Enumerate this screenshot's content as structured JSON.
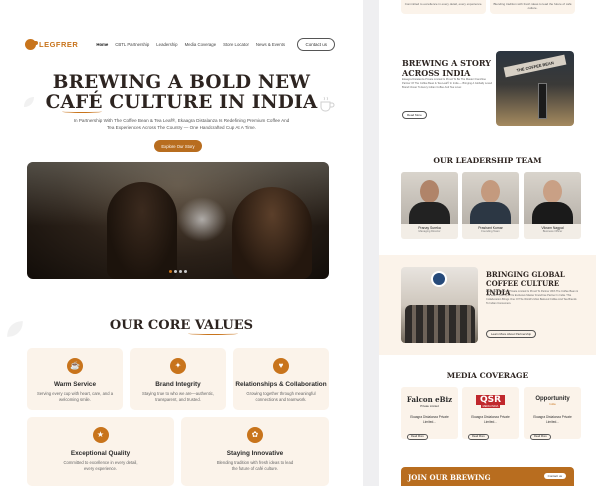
{
  "brand": {
    "logo_text": "LEGFRER",
    "accent": "#c8741c"
  },
  "nav": {
    "links": [
      "Home",
      "CBTL Partnership",
      "Leadership",
      "Media Coverage",
      "Store Locator",
      "News & Events"
    ],
    "contact": "Contact us"
  },
  "hero": {
    "title_line1": "BREWING A BOLD NEW",
    "title_line2": "CAFÉ CULTURE IN INDIA",
    "subtitle": "In Partnership With The Coffee Bean & Tea Leaf®, Ekaagra Distalanza Is Redefining Premium Coffee And Tea Experiences Across The Country — One Handcrafted Cup At A Time.",
    "cta": "Explore Our Story",
    "slider_count": 4,
    "slider_active": 0
  },
  "values": {
    "title": "OUR CORE VALUES",
    "cards": [
      {
        "title": "Warm Service",
        "desc": "Serving every cup with heart, care, and a welcoming smile.",
        "icon": "☕"
      },
      {
        "title": "Brand Integrity",
        "desc": "Staying true to who we are—authentic, transparent, and trusted.",
        "icon": "✦"
      },
      {
        "title": "Relationships & Collaboration",
        "desc": "Growing together through meaningful connections and teamwork.",
        "icon": "♥"
      },
      {
        "title": "Exceptional Quality",
        "desc": "Committed to excellence in every detail, every experience.",
        "icon": "★"
      },
      {
        "title": "Staying Innovative",
        "desc": "Blending tradition with fresh ideas to lead the future of café culture.",
        "icon": "✿"
      }
    ]
  },
  "right": {
    "top_cards": [
      "Committed to excellence in every detail, every experience.",
      "Blending tradition with fresh ideas to lead the future of café culture."
    ],
    "story": {
      "title_line1": "BREWING A STORY",
      "title_line2": "ACROSS INDIA",
      "body": "Ekaagra Distalanza Private Limited Is Proud To Be The Master Franchise Partner Of The Coffee Bean & Tea Leaf® In India — Bringing A Globally Loved Brand Closer To Every Indian Coffee And Tea Lover.",
      "button": "Read More",
      "store_sign": "THE COFFEE BEAN"
    },
    "leadership": {
      "title": "OUR LEADERSHIP TEAM",
      "people": [
        {
          "name": "Pranay Sureka",
          "role": "Managing Director"
        },
        {
          "name": "Prashant Kumar",
          "role": "Founding Team"
        },
        {
          "name": "Vikram Nagpal",
          "role": "Business Officer"
        }
      ]
    },
    "global": {
      "title_line1": "BRINGING GLOBAL",
      "title_line2": "COFFEE CULTURE INDIA",
      "body": "Ekaagra Distalanza Private Limited Is Proud To Partner With The Coffee Bean & Tea Leaf® (CBTL) As Its Exclusive Master Franchise Partner In India. This Collaboration Brings One Of The World's Most Beloved Coffee And Tea Brands To Indian Consumers.",
      "button": "Learn More About Partnership"
    },
    "media": {
      "title": "MEDIA COVERAGE",
      "items": [
        {
          "logo": "Falcon eBiz",
          "logo_sub": "Private Limited",
          "text": "Ekaagra Distalanza Private Limited...",
          "button": "Read More"
        },
        {
          "logo": "QSR",
          "logo_sub": "MEDIA INDIA",
          "text": "Ekaagra Distalanza Private Limited...",
          "button": "Read More"
        },
        {
          "logo": "Opportunity",
          "logo_sub": "India",
          "text": "Ekaagra Distalanza Private Limited...",
          "button": "Read More"
        }
      ]
    },
    "join": {
      "title": "JOIN OUR BREWING",
      "button": "Contact us"
    }
  }
}
